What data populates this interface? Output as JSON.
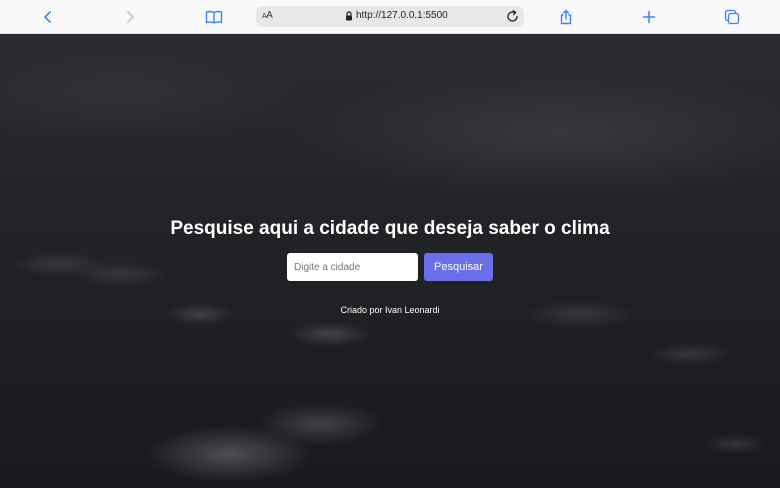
{
  "browser": {
    "text_size_label_small": "A",
    "text_size_label_large": "A",
    "url": "http://127.0.0.1:5500",
    "accent_color": "#3b82f6",
    "icons": [
      "chevron-left-icon",
      "chevron-right-icon",
      "book-icon",
      "lock-icon",
      "reload-icon",
      "share-icon",
      "plus-icon",
      "tabs-icon"
    ]
  },
  "page": {
    "headline": "Pesquise aqui a cidade que deseja saber o clima",
    "search": {
      "placeholder": "Digite a cidade",
      "value": "",
      "button_label": "Pesquisar",
      "button_color": "#6a6ee8"
    },
    "credits": "Criado por Ivan Leonardi"
  }
}
